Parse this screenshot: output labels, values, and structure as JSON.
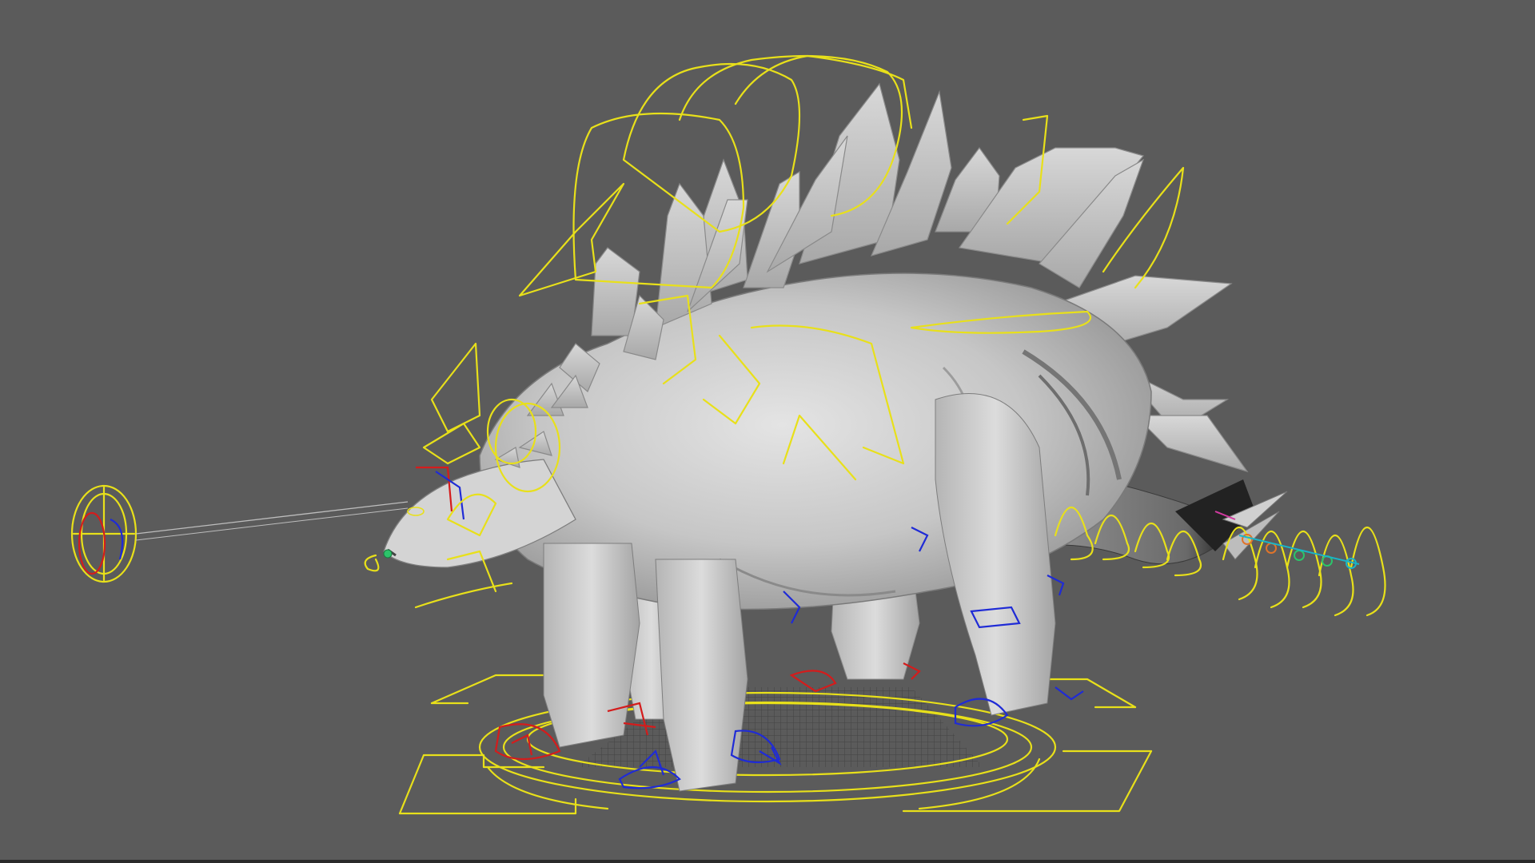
{
  "viewport": {
    "background": "#5b5b5b",
    "model_name": "stegosaurus-mesh",
    "mesh_color": "#c9c9c9",
    "mesh_shadow_color": "#8c8c8c"
  },
  "controls": {
    "primary_color": "#e8e01a",
    "left_side_color": "#d41c1c",
    "right_side_color": "#1f2bd6",
    "tail_tip_colors": [
      "#e0742a",
      "#2cc46a",
      "#19b5c8",
      "#d13aa0"
    ]
  },
  "icons": {
    "look_at_control": "target-crosshair-icon",
    "root_control": "root-arrows-icon"
  }
}
